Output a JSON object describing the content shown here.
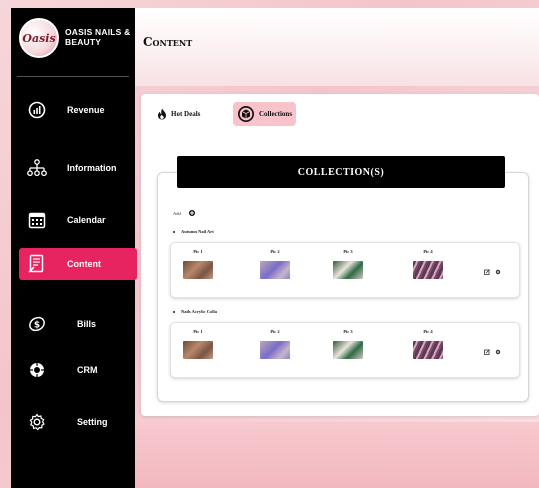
{
  "brand": {
    "logo_text": "Oasis",
    "name": "OASIS NAILS & BEAUTY"
  },
  "nav": [
    {
      "label": "Revenue",
      "icon": "revenue-icon"
    },
    {
      "label": "Information",
      "icon": "sitemap-icon"
    },
    {
      "label": "Calendar",
      "icon": "calendar-icon"
    },
    {
      "label": "Content",
      "icon": "content-icon",
      "active": true
    },
    {
      "label": "Bills",
      "icon": "bills-icon"
    },
    {
      "label": "CRM",
      "icon": "crm-icon"
    },
    {
      "label": "Setting",
      "icon": "gear-icon"
    }
  ],
  "header": {
    "title": "Content"
  },
  "tabs": [
    {
      "label": "Hot Deals",
      "icon": "fire-icon"
    },
    {
      "label": "Collections",
      "icon": "box-icon",
      "active": true
    }
  ],
  "collections": {
    "title": "COLLECTION(S)",
    "add_label": "Add",
    "groups": [
      {
        "title": "Autumn Nail Art",
        "pics": [
          "Pic 1",
          "Pic 2",
          "Pic 3",
          "Pic 4"
        ]
      },
      {
        "title": "Nails Acrylic Colla",
        "pics": [
          "Pic 1",
          "Pic 2",
          "Pic 3",
          "Pic 4"
        ]
      }
    ]
  },
  "colors": {
    "sidebar": "#000000",
    "active_nav": "#e7245f",
    "active_tab": "#f8c3cb",
    "background": "#f6d6da"
  }
}
